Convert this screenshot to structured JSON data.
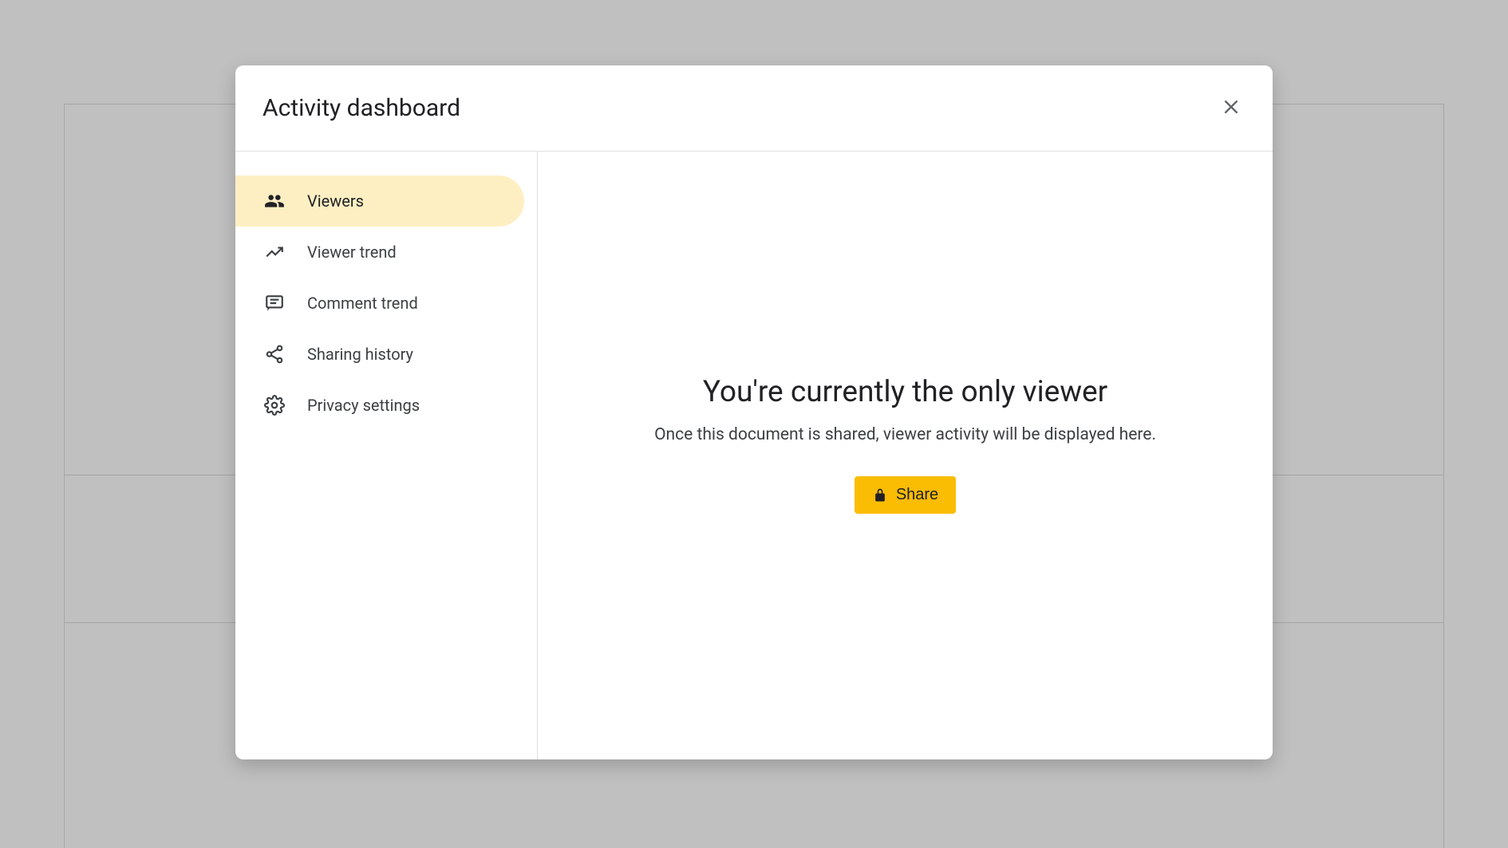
{
  "modal": {
    "title": "Activity dashboard"
  },
  "sidebar": {
    "items": [
      {
        "label": "Viewers",
        "active": true
      },
      {
        "label": "Viewer trend",
        "active": false
      },
      {
        "label": "Comment trend",
        "active": false
      },
      {
        "label": "Sharing history",
        "active": false
      },
      {
        "label": "Privacy settings",
        "active": false
      }
    ]
  },
  "content": {
    "heading": "You're currently the only viewer",
    "subtext": "Once this document is shared, viewer activity will be displayed here.",
    "share_label": "Share"
  },
  "colors": {
    "accent": "#fbbc04",
    "sidebar_active_bg": "#feefc3"
  }
}
